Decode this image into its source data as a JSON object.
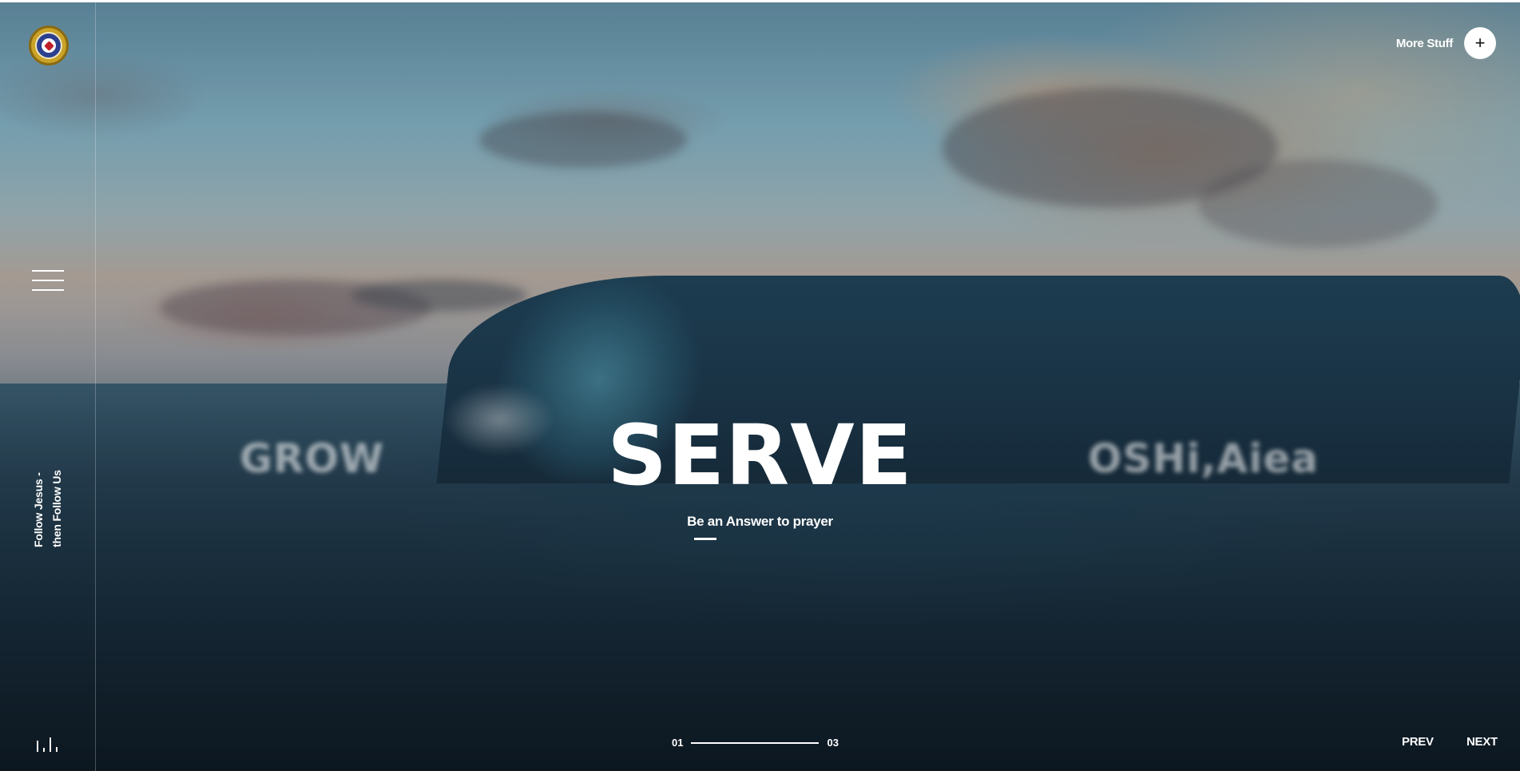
{
  "brand": {
    "logo_icon": "church-seal-icon"
  },
  "sidebar": {
    "tagline_line1": "Follow Jesus -",
    "tagline_line2": "then Follow Us",
    "menu_icon": "hamburger-menu-icon",
    "audio_icon": "sound-bars-icon"
  },
  "header": {
    "more_label": "More Stuff",
    "more_button_symbol": "+"
  },
  "slider": {
    "prev_slide_label": "GROW",
    "current_title": "SERVE",
    "current_subtitle": "Be an Answer to prayer",
    "next_slide_label": "OSHi,Aiea",
    "current_index": "01",
    "total": "03",
    "progress_fraction": 0.33
  },
  "nav": {
    "prev_label": "PREV",
    "next_label": "NEXT"
  },
  "colors": {
    "text": "#ffffff",
    "sea_dark": "#101f2b",
    "logo_gold": "#c9a227",
    "logo_blue": "#2c3f8f",
    "logo_heart": "#c0202a"
  }
}
